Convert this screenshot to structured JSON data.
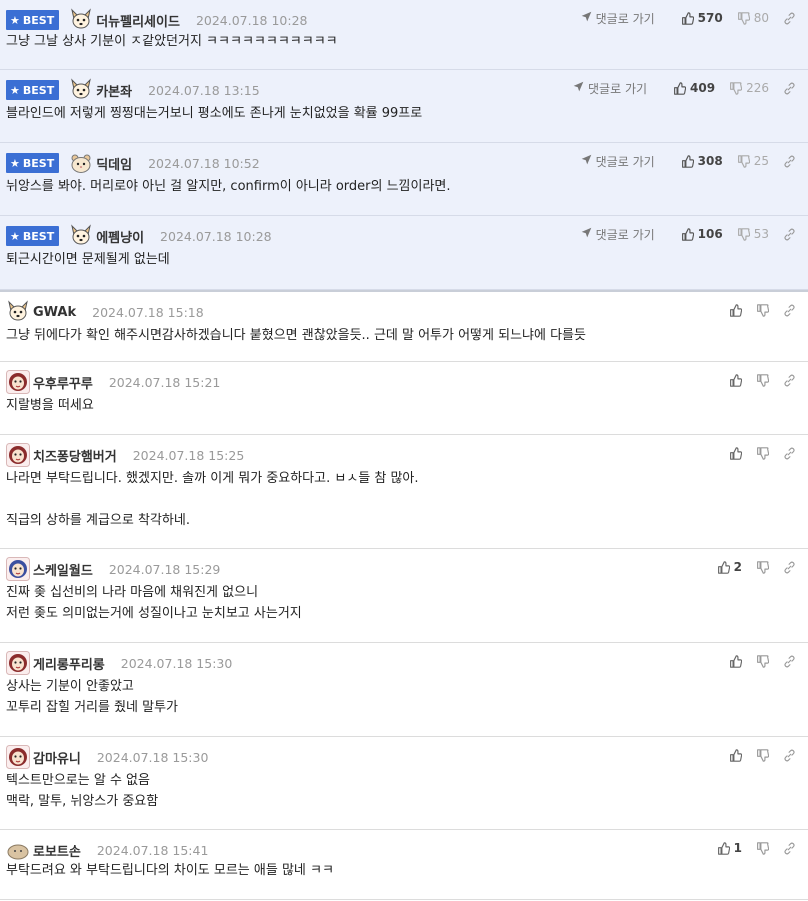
{
  "best_label": "BEST",
  "goto_label": "댓글로 가기",
  "comments": [
    {
      "best": true,
      "avatar": "dog",
      "nick": "더뉴펠리세이드",
      "date": "2024.07.18 10:28",
      "up": "570",
      "down": "80",
      "text": "그냥 그날 상사 기분이 ㅈ같았던거지 ㅋㅋㅋㅋㅋㅋㅋㅋㅋㅋㅋ"
    },
    {
      "best": true,
      "avatar": "dog",
      "nick": "카본좌",
      "date": "2024.07.18 13:15",
      "up": "409",
      "down": "226",
      "text": "블라인드에 저렇게 찡찡대는거보니 평소에도 존나게 눈치없었을 확률 99프로"
    },
    {
      "best": true,
      "avatar": "hamster",
      "nick": "딕데임",
      "date": "2024.07.18 10:52",
      "up": "308",
      "down": "25",
      "text": "뉘앙스를 봐야. 머리로야 아닌 걸 알지만, confirm이 아니라 order의 느낌이라면."
    },
    {
      "best": true,
      "avatar": "dog",
      "nick": "에펨냥이",
      "date": "2024.07.18 10:28",
      "up": "106",
      "down": "53",
      "text": "퇴근시간이면 문제될게 없는데"
    },
    {
      "best": false,
      "avatar": "dog",
      "nick": "GWAk",
      "date": "2024.07.18 15:18",
      "up": "",
      "down": "",
      "text": "그냥 뒤에다가 확인 해주시면감사하겠습니다 붙혔으면 괜찮았을듯.. 근데 말 어투가 어떻게 되느냐에 다를듯"
    },
    {
      "best": false,
      "avatar": "monkey",
      "nick": "우후루꾸루",
      "date": "2024.07.18 15:21",
      "up": "",
      "down": "",
      "text": "지랄병을 떠세요"
    },
    {
      "best": false,
      "avatar": "monkey",
      "nick": "치즈퐁당햄버거",
      "date": "2024.07.18 15:25",
      "up": "",
      "down": "",
      "text": "나라면 부탁드립니다. 했겠지만. 솔까 이게 뭐가 중요하다고. ㅂㅅ들 참 많아.\n\n직급의 상하를 계급으로 착각하네."
    },
    {
      "best": false,
      "avatar": "monkey2",
      "nick": "스케일월드",
      "date": "2024.07.18 15:29",
      "up": "2",
      "down": "",
      "text": "진짜 좆 십선비의 나라 마음에 채워진게 없으니\n저런 좆도 의미없는거에 성질이나고 눈치보고 사는거지"
    },
    {
      "best": false,
      "avatar": "monkey",
      "nick": "게리롱푸리롱",
      "date": "2024.07.18 15:30",
      "up": "",
      "down": "",
      "text": "상사는 기분이 안좋았고\n꼬투리 잡힐 거리를 줬네 말투가"
    },
    {
      "best": false,
      "avatar": "monkey",
      "nick": "감마유니",
      "date": "2024.07.18 15:30",
      "up": "",
      "down": "",
      "text": "텍스트만으로는 알 수 없음\n맥락, 말투, 뉘앙스가 중요함"
    },
    {
      "best": false,
      "avatar": "potato",
      "nick": "로보트손",
      "date": "2024.07.18 15:41",
      "up": "1",
      "down": "",
      "text": "부탁드려요 와 부탁드립니다의 차이도 모르는 애들 많네 ㅋㅋ"
    }
  ]
}
